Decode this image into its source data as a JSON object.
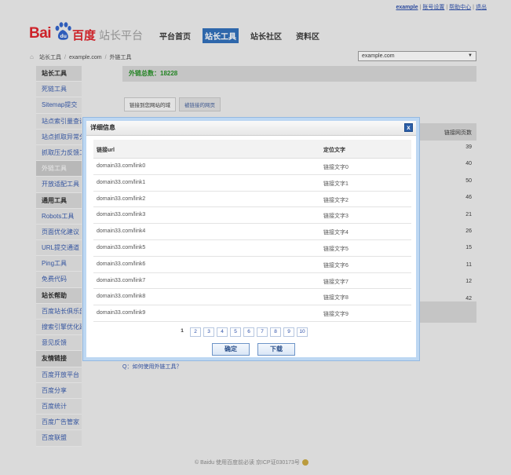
{
  "top_links": {
    "user": "example",
    "account": "账号设置",
    "help": "帮助中心",
    "logout": "退出"
  },
  "logo": {
    "bai": "Bai",
    "du": "百度"
  },
  "site_title": "站长平台",
  "nav": [
    "平台首页",
    "站长工具",
    "站长社区",
    "资料区"
  ],
  "breadcrumb": [
    "站长工具",
    "example.com",
    "外链工具"
  ],
  "site_select": "example.com",
  "sidebar": [
    {
      "label": "站长工具",
      "type": "head"
    },
    {
      "label": "死链工具",
      "type": "link"
    },
    {
      "label": "Sitemap提交",
      "type": "link"
    },
    {
      "label": "站点索引量查询",
      "type": "link"
    },
    {
      "label": "站点抓取异常分析",
      "type": "link"
    },
    {
      "label": "抓取压力反馈工具",
      "type": "link"
    },
    {
      "label": "外链工具",
      "type": "active"
    },
    {
      "label": "开放适配工具",
      "type": "link"
    },
    {
      "label": "通用工具",
      "type": "head"
    },
    {
      "label": "Robots工具",
      "type": "link"
    },
    {
      "label": "页面优化建议",
      "type": "link"
    },
    {
      "label": "URL提交通道",
      "type": "link"
    },
    {
      "label": "Ping工具",
      "type": "link"
    },
    {
      "label": "免费代码",
      "type": "link"
    },
    {
      "label": "站长帮助",
      "type": "head"
    },
    {
      "label": "百度站长俱乐部",
      "type": "link"
    },
    {
      "label": "搜索引擎优化建议",
      "type": "link"
    },
    {
      "label": "意见反馈",
      "type": "link"
    },
    {
      "label": "友情链接",
      "type": "head"
    },
    {
      "label": "百度开放平台",
      "type": "link"
    },
    {
      "label": "百度分享",
      "type": "link"
    },
    {
      "label": "百度统计",
      "type": "link"
    },
    {
      "label": "百度广告管家",
      "type": "link"
    },
    {
      "label": "百度联盟",
      "type": "link"
    }
  ],
  "main": {
    "total": "外链总数：18228",
    "tabs": [
      "链接到您网站的域",
      "被链接的网页"
    ],
    "count_header": "链接网页数",
    "counts": [
      "39",
      "40",
      "50",
      "46",
      "21",
      "26",
      "15",
      "11",
      "12",
      "42"
    ],
    "faq": "Q：如何使用外链工具？"
  },
  "dialog": {
    "title": "详细信息",
    "close": "x",
    "headers": {
      "url": "链接url",
      "anchor": "定位文字"
    },
    "rows": [
      {
        "url": "domain33.com/link0",
        "anchor": "链接文字0"
      },
      {
        "url": "domain33.com/link1",
        "anchor": "链接文字1"
      },
      {
        "url": "domain33.com/link2",
        "anchor": "链接文字2"
      },
      {
        "url": "domain33.com/link3",
        "anchor": "链接文字3"
      },
      {
        "url": "domain33.com/link4",
        "anchor": "链接文字4"
      },
      {
        "url": "domain33.com/link5",
        "anchor": "链接文字5"
      },
      {
        "url": "domain33.com/link6",
        "anchor": "链接文字6"
      },
      {
        "url": "domain33.com/link7",
        "anchor": "链接文字7"
      },
      {
        "url": "domain33.com/link8",
        "anchor": "链接文字8"
      },
      {
        "url": "domain33.com/link9",
        "anchor": "链接文字9"
      }
    ],
    "pages": [
      "1",
      "2",
      "3",
      "4",
      "5",
      "6",
      "7",
      "8",
      "9",
      "10"
    ],
    "current_page": "1",
    "confirm": "确定",
    "download": "下载"
  },
  "footer": "© Baidu 使用百度前必读 京ICP证030173号"
}
